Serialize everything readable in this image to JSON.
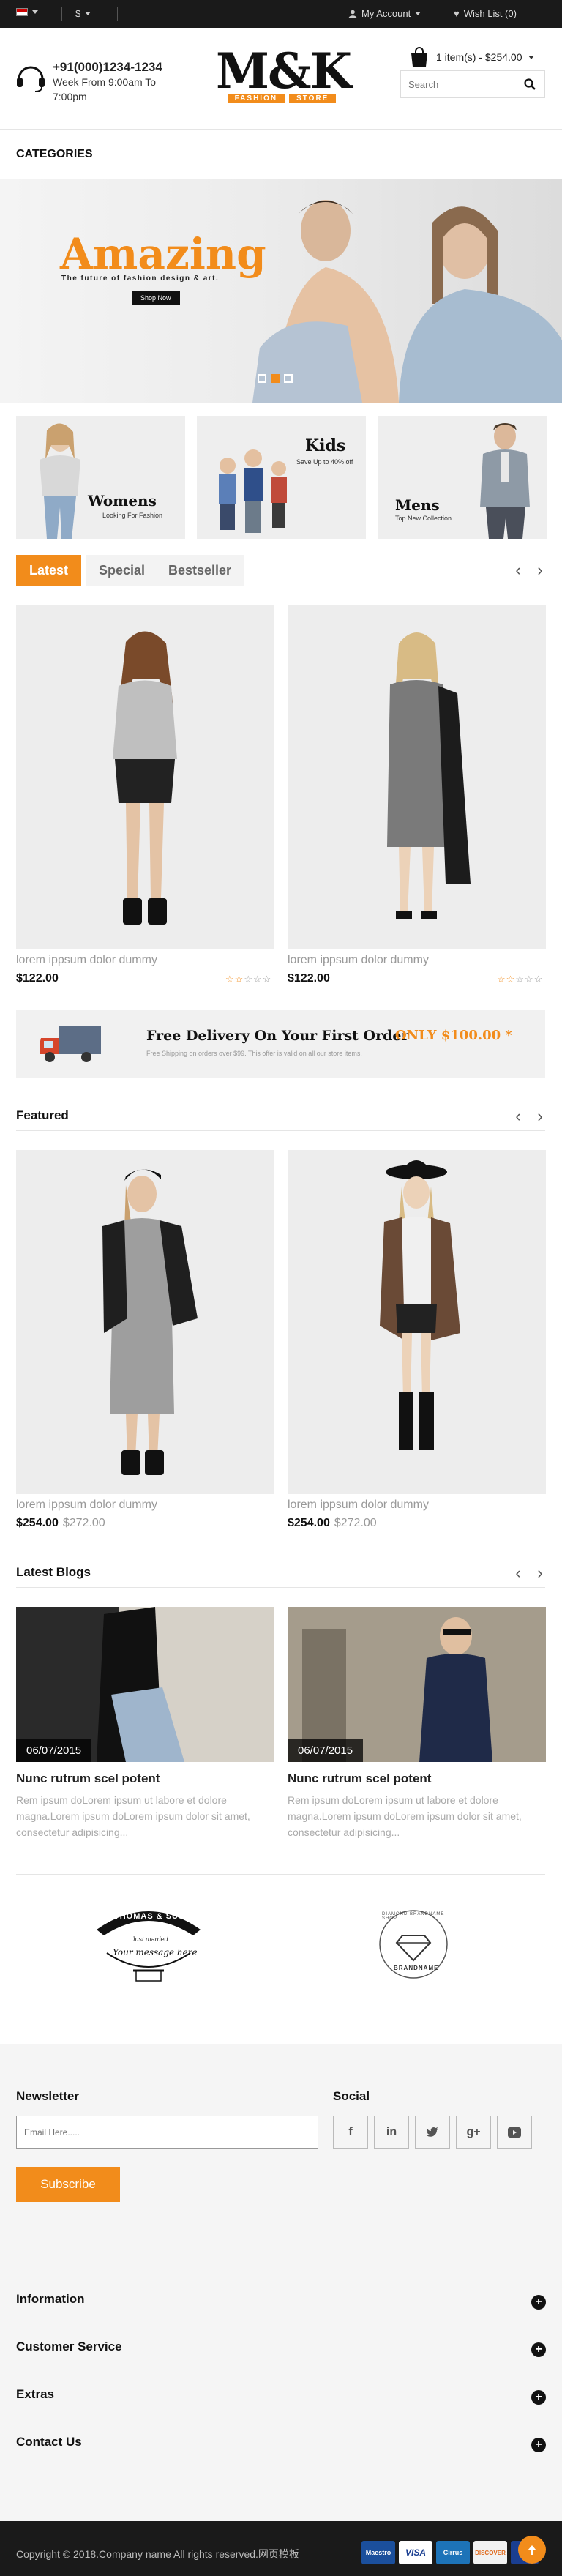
{
  "topbar": {
    "currency": "$",
    "account_label": "My Account",
    "wishlist_label": "Wish List (0)"
  },
  "header": {
    "phone": "+91(000)1234-1234",
    "hours_line1": "Week From 9:00am To",
    "hours_line2": "7:00pm",
    "logo_text": "M&K",
    "logo_word1": "FASHION",
    "logo_word2": "STORE",
    "cart_label": "1 item(s) - $254.00",
    "search_placeholder": "Search"
  },
  "categories_title": "CATEGORIES",
  "hero": {
    "headline": "Amazing",
    "subline": "The future of fashion design & art.",
    "button": "Shop Now"
  },
  "category_banners": [
    {
      "title": "Womens",
      "subtitle": "Looking For Fashion"
    },
    {
      "title": "Kids",
      "subtitle": "Save Up to 40% off"
    },
    {
      "title": "Mens",
      "subtitle": "Top New Collection"
    }
  ],
  "tabs": [
    "Latest",
    "Special",
    "Bestseller"
  ],
  "latest_products": [
    {
      "name": "lorem ippsum dolor dummy",
      "price": "$122.00"
    },
    {
      "name": "lorem ippsum dolor dummy",
      "price": "$122.00"
    }
  ],
  "delivery": {
    "title": "Free Delivery On Your First Order",
    "highlight": "ONLY $100.00 *",
    "note": "Free Shipping on orders over $99. This offer is valid on all our store items."
  },
  "featured": {
    "title": "Featured",
    "products": [
      {
        "name": "lorem ippsum dolor dummy",
        "price": "$254.00",
        "old_price": "$272.00"
      },
      {
        "name": "lorem ippsum dolor dummy",
        "price": "$254.00",
        "old_price": "$272.00"
      }
    ]
  },
  "blogs": {
    "title": "Latest Blogs",
    "posts": [
      {
        "date": "06/07/2015",
        "title": "Nunc rutrum scel potent",
        "desc": "Rem ipsum doLorem ipsum ut labore et dolore magna.Lorem ipsum doLorem ipsum dolor sit amet, consectetur adipisicing..."
      },
      {
        "date": "06/07/2015",
        "title": "Nunc rutrum scel potent",
        "desc": "Rem ipsum doLorem ipsum ut labore et dolore magna.Lorem ipsum doLorem ipsum dolor sit amet, consectetur adipisicing..."
      }
    ]
  },
  "brands": [
    {
      "top": "THOMAS & SUSI",
      "mid": "Just married",
      "bottom": "Your message here"
    },
    {
      "top": "DIAMOND BRANDNAME SHOP",
      "bottom": "BRANDNAME"
    }
  ],
  "footer": {
    "newsletter_title": "Newsletter",
    "email_placeholder": "Email Here.....",
    "subscribe": "Subscribe",
    "social_title": "Social",
    "links": [
      "Information",
      "Customer Service",
      "Extras",
      "Contact Us"
    ],
    "copyright": "Copyright © 2018.Company name All rights reserved.网页模板",
    "payments": [
      "Maestro",
      "VISA",
      "Cirrus",
      "DISCOVER",
      "Visa"
    ]
  },
  "colors": {
    "accent": "#f28c1b",
    "dark": "#1a1a1a"
  }
}
